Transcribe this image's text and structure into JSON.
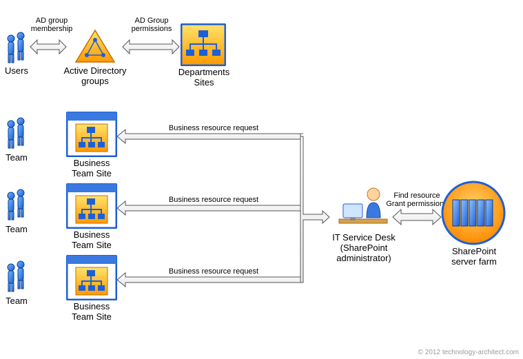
{
  "nodes": {
    "users": {
      "label": "Users"
    },
    "ad_groups": {
      "label": "Active Directory\ngroups"
    },
    "dept_sites": {
      "label": "Departments\nSites"
    },
    "team1": {
      "label": "Team"
    },
    "team2": {
      "label": "Team"
    },
    "team3": {
      "label": "Team"
    },
    "bts1": {
      "label": "Business\nTeam Site"
    },
    "bts2": {
      "label": "Business\nTeam Site"
    },
    "bts3": {
      "label": "Business\nTeam Site"
    },
    "it_desk": {
      "label": "IT Service Desk\n(SharePoint\nadministrator)"
    },
    "sp_farm": {
      "label": "SharePoint\nserver farm"
    }
  },
  "edges": {
    "users_ad": {
      "label": "AD group\nmembership"
    },
    "ad_dept": {
      "label": "AD Group\npermissions"
    },
    "bts1_it": {
      "label": "Business resource request"
    },
    "bts2_it": {
      "label": "Business resource request"
    },
    "bts3_it": {
      "label": "Business resource request"
    },
    "it_sp": {
      "label": "Find resource\nGrant permissions"
    }
  },
  "footer": "© 2012 technology-architect.com"
}
